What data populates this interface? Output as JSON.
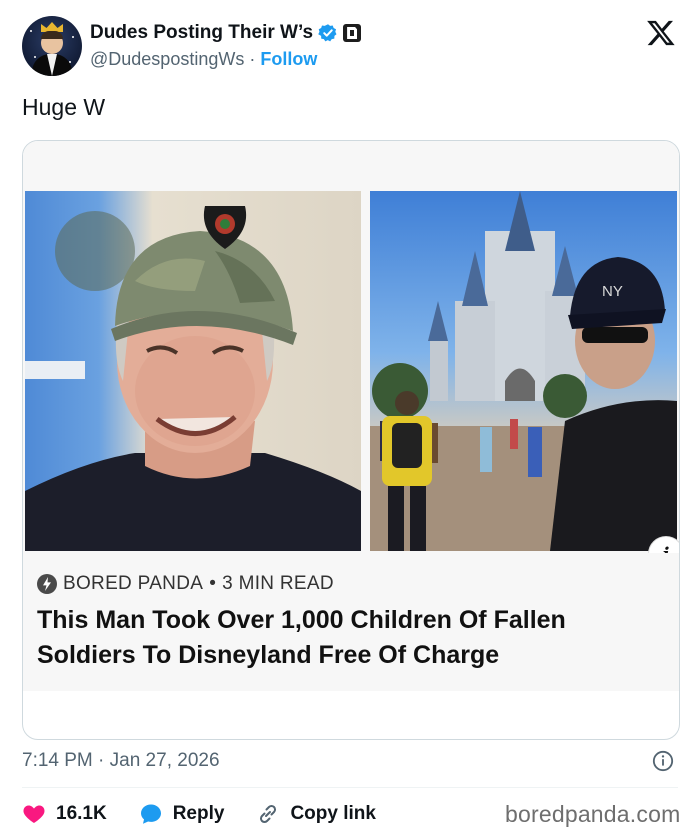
{
  "header": {
    "display_name": "Dudes Posting Their W’s",
    "handle": "@DudespostingWs",
    "separator": "·",
    "follow_label": "Follow"
  },
  "tweet": {
    "text": "Huge W"
  },
  "card": {
    "source": "BORED PANDA",
    "dot": "•",
    "read_time": "3 MIN READ",
    "headline": "This Man Took Over 1,000 Children Of Fallen Soldiers To Disneyland Free Of Charge",
    "info_glyph": "i",
    "cap_text": "NY"
  },
  "meta": {
    "time": "7:14 PM · Jan 27, 2026"
  },
  "actions": {
    "likes": "16.1K",
    "reply_label": "Reply",
    "copy_label": "Copy link"
  },
  "watermark": "boredpanda.com",
  "colors": {
    "like": "#f91880",
    "reply": "#1d9bf0",
    "follow": "#1d9bf0",
    "verified": "#1d9bf0"
  },
  "icons": [
    "crown-avatar",
    "verified-badge-icon",
    "affiliate-badge-icon",
    "x-logo-icon",
    "bolt-icon",
    "info-icon",
    "heart-icon",
    "reply-bubble-icon",
    "link-icon"
  ]
}
